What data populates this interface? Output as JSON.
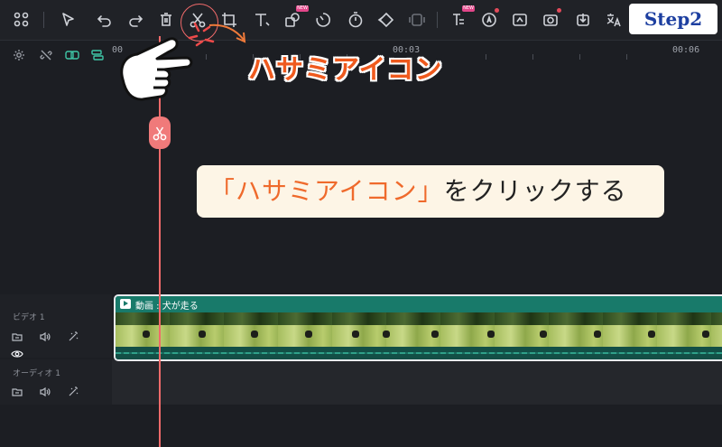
{
  "toolbar": {
    "icons": [
      "grid-icon",
      "select-icon",
      "undo-icon",
      "redo-icon",
      "delete-icon",
      "scissors-icon",
      "crop-icon",
      "text-icon",
      "shapes-icon",
      "speed-icon",
      "timer-icon",
      "keyframe-icon",
      "freeze-icon",
      "ai-text-icon",
      "ai-voice-icon",
      "ai-cutout-icon",
      "ai-camera-icon",
      "ai-export-icon",
      "translate-icon"
    ],
    "new_badge_1": "NEW",
    "new_badge_2": "NEW"
  },
  "step_label": "Step2",
  "timeline": {
    "ruler": {
      "t0": "00",
      "t1": "00:03",
      "t2": "00:06"
    },
    "tracks": [
      {
        "label": "ビデオ 1"
      },
      {
        "label": "オーディオ 1"
      }
    ],
    "clip": {
      "title": "動画 : 犬が走る"
    }
  },
  "annotation": {
    "big_label": "ハサミアイコン",
    "callout_quote_open": "「",
    "callout_highlight": "ハサミアイコン",
    "callout_quote_close": "」",
    "callout_rest": "をクリックする"
  },
  "colors": {
    "accent": "#ef5a1e",
    "playhead": "#f06a6a",
    "clip": "#1a6e61",
    "step_text": "#1d3fa0"
  }
}
